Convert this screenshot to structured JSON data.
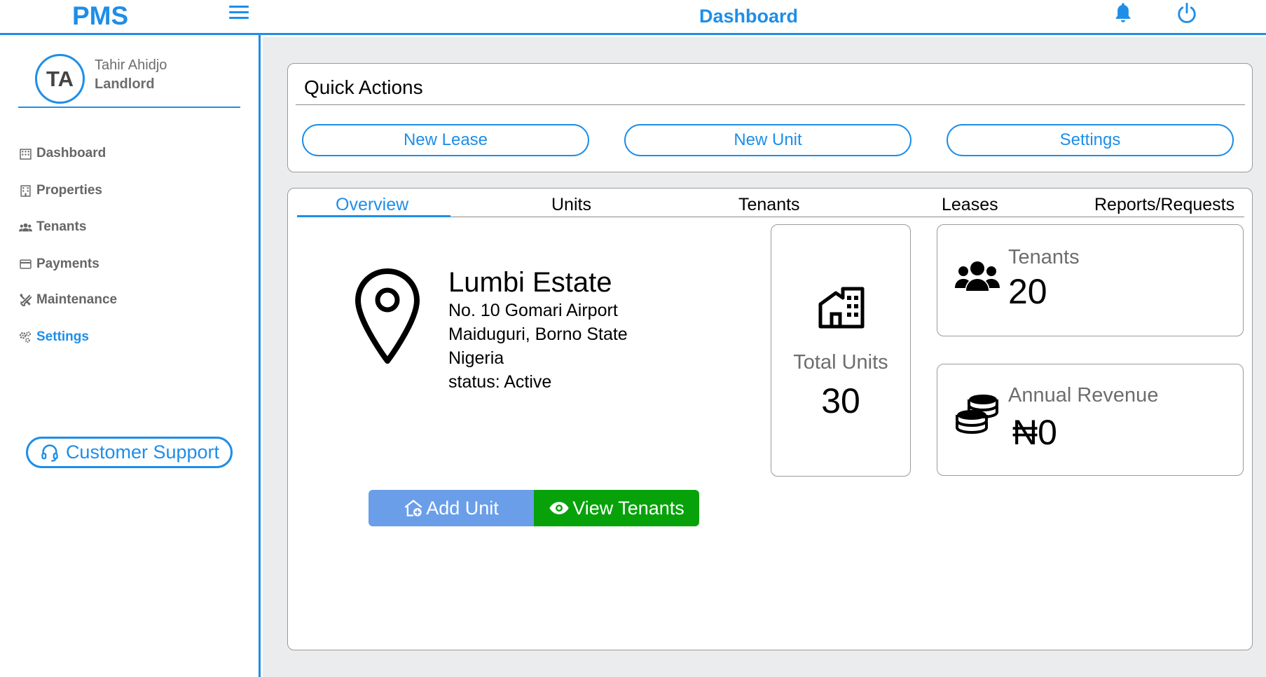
{
  "header": {
    "brand": "PMS",
    "title": "Dashboard",
    "menu_icon": "hamburger-icon",
    "notification_icon": "bell-icon",
    "power_icon": "power-icon"
  },
  "user": {
    "initials": "TA",
    "name": "Tahir Ahidjo",
    "role": "Landlord"
  },
  "sidebar": {
    "items": [
      {
        "label": "Dashboard",
        "icon": "building-grid-icon"
      },
      {
        "label": "Properties",
        "icon": "building-icon"
      },
      {
        "label": "Tenants",
        "icon": "users-icon"
      },
      {
        "label": "Payments",
        "icon": "credit-card-icon"
      },
      {
        "label": "Maintenance",
        "icon": "tools-icon"
      },
      {
        "label": "Settings",
        "icon": "gears-icon"
      }
    ],
    "active": "Settings",
    "support_label": "Customer Support"
  },
  "quick_actions": {
    "title": "Quick Actions",
    "buttons": [
      "New Lease",
      "New Unit",
      "Settings"
    ]
  },
  "tabs": {
    "items": [
      "Overview",
      "Units",
      "Tenants",
      "Leases",
      "Reports/Requests"
    ],
    "active": "Overview"
  },
  "property": {
    "name": "Lumbi Estate",
    "address_line1": "No. 10 Gomari Airport",
    "address_line2": "Maiduguri, Borno State",
    "country": "Nigeria",
    "status": "status: Active"
  },
  "actions": {
    "add_unit": "Add Unit",
    "view_tenants": "View Tenants"
  },
  "stats": {
    "total_units_label": "Total Units",
    "total_units_value": "30",
    "tenants_label": "Tenants",
    "tenants_value": "20",
    "revenue_label": "Annual Revenue",
    "revenue_value": "₦0"
  },
  "colors": {
    "accent": "#1e8ee8",
    "add_unit_bg": "#6a9ee9",
    "view_tenants_bg": "#07a20a",
    "main_bg": "#ebeced"
  }
}
